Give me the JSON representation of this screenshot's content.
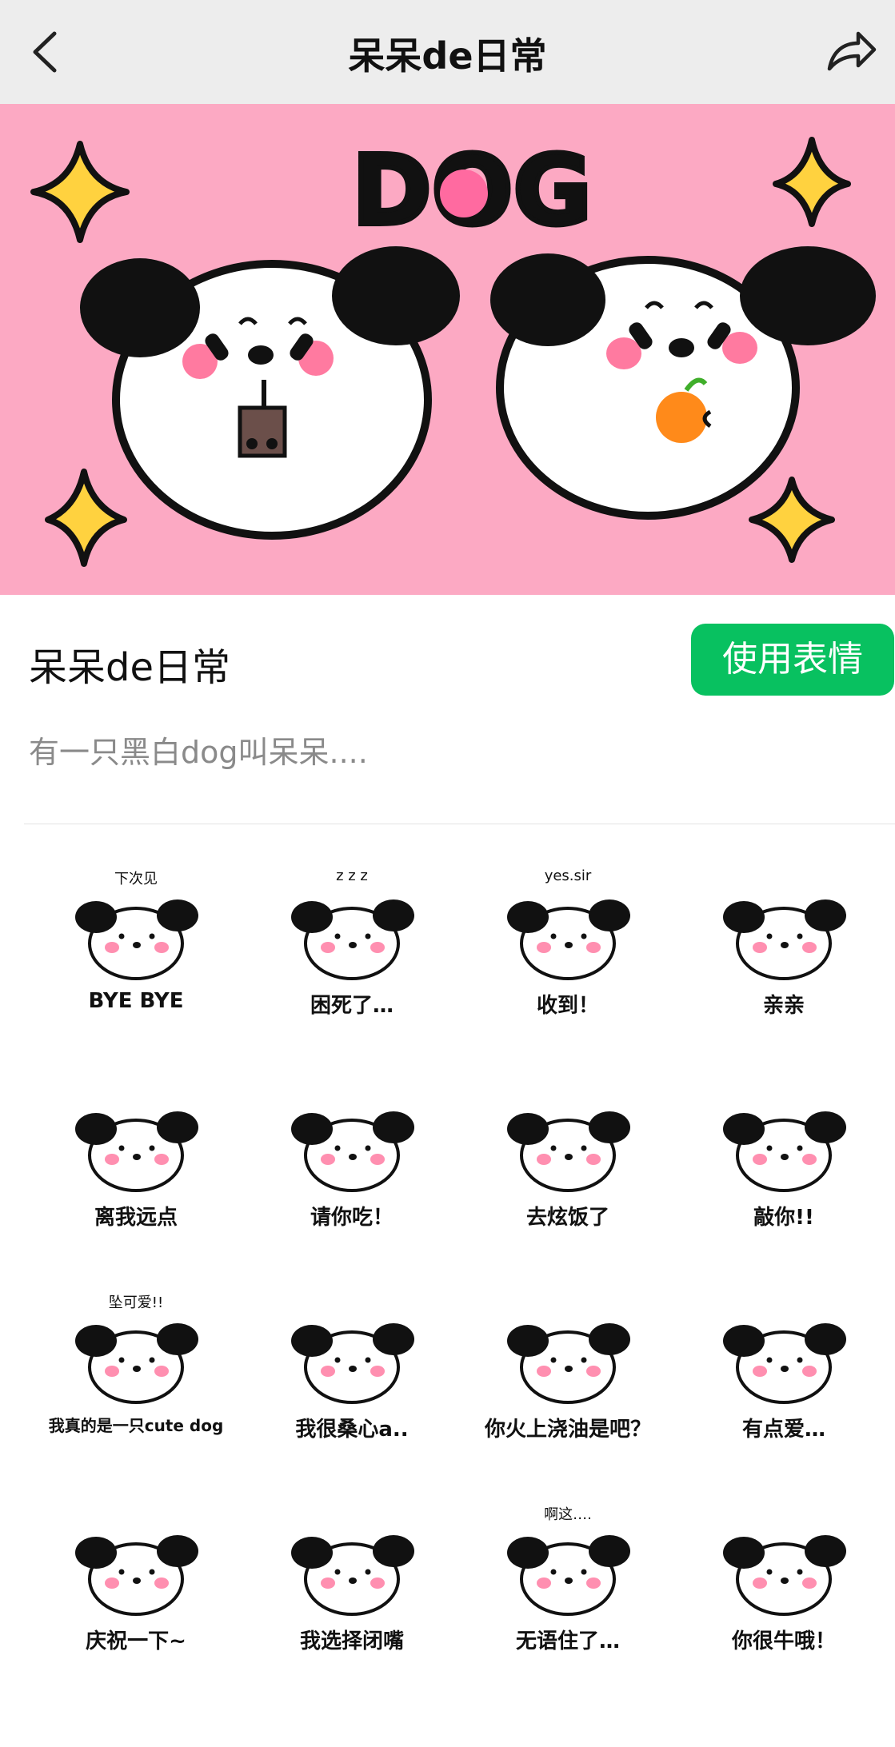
{
  "nav": {
    "title": "呆呆de日常",
    "back_icon": "chevron-left-icon",
    "share_icon": "share-icon"
  },
  "banner": {
    "wordmark": "DOG"
  },
  "pack": {
    "title": "呆呆de日常",
    "use_button": "使用表情",
    "description": "有一只黑白dog叫呆呆...."
  },
  "stickers": [
    {
      "top": "下次见",
      "caption": "BYE BYE"
    },
    {
      "top": "z z z",
      "caption": "困死了…"
    },
    {
      "top": "yes.sir",
      "caption": "收到！"
    },
    {
      "top": "",
      "caption": "亲亲"
    },
    {
      "top": "",
      "caption": "离我远点"
    },
    {
      "top": "",
      "caption": "请你吃！"
    },
    {
      "top": "",
      "caption": "去炫饭了"
    },
    {
      "top": "",
      "caption": "敲你!!"
    },
    {
      "top": "坠可爱!!",
      "caption": "我真的是一只cute dog"
    },
    {
      "top": "",
      "caption": "我很桑心a.."
    },
    {
      "top": "",
      "caption": "你火上浇油是吧？"
    },
    {
      "top": "",
      "caption": "有点爱…"
    },
    {
      "top": "",
      "caption": "庆祝一下~"
    },
    {
      "top": "",
      "caption": "我选择闭嘴"
    },
    {
      "top": "啊这….",
      "caption": "无语住了…"
    },
    {
      "top": "",
      "caption": "你很牛哦！"
    }
  ]
}
